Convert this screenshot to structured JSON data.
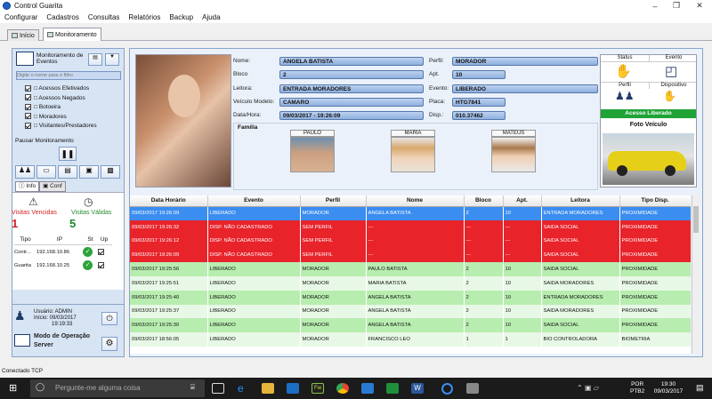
{
  "window": {
    "title": "Control Guarita"
  },
  "menu": [
    "Configurar",
    "Cadastros",
    "Consultas",
    "Relatórios",
    "Backup",
    "Ajuda"
  ],
  "tabs": [
    {
      "label": "Início"
    },
    {
      "label": "Monitoramento"
    }
  ],
  "left": {
    "monitor_title": "Monitoramento de Eventos",
    "search_placeholder": "Digite o nome para o filtro",
    "filters": [
      "Acessos Efetivados",
      "Acessos Negados",
      "Botoeira",
      "Moradores",
      "Visitantes/Prestadores"
    ],
    "pause_label": "Pausar Monitoramento",
    "subtabs": [
      "Info",
      "Conf"
    ],
    "visitas_vencidas_label": "Visitas Vencidas",
    "visitas_vencidas_count": "1",
    "visitas_validas_label": "Visitas Válidas",
    "visitas_validas_count": "5",
    "device_headers": [
      "Tipo",
      "IP",
      "St",
      "Up"
    ],
    "devices": [
      {
        "tipo": "Contr...",
        "ip": "192.168.10.86"
      },
      {
        "tipo": "Guarita",
        "ip": "192.168.10.25"
      }
    ],
    "user_info": {
      "line1": "Usuário: ADMIN",
      "line2": "Início: 09/03/2017",
      "line3": "19:19:33"
    },
    "mode_label": "Modo de Operação",
    "mode_value": "Server"
  },
  "detail": {
    "nome_label": "Nome:",
    "nome": "ANGELA BATISTA",
    "bloco_label": "Bloco",
    "bloco": "2",
    "leitora_label": "Leitora:",
    "leitora": "ENTRADA MORADORES",
    "veiculo_label": "Veículo Modelo:",
    "veiculo": "CAMARO",
    "datahora_label": "Data/Hora:",
    "datahora": "09/03/2017 - 19:26:09",
    "perfil_label": "Perfil:",
    "perfil": "MORADOR",
    "apt_label": "Apt.",
    "apt": "10",
    "evento_label": "Evento:",
    "evento": "LIBERADO",
    "placa_label": "Placa:",
    "placa": "HTG7841",
    "disp_label": "Disp.:",
    "disp": "010.37462",
    "familia_label": "Família",
    "familia": [
      {
        "nome": "PAULO"
      },
      {
        "nome": "MARIA"
      },
      {
        "nome": "MATEUS"
      }
    ]
  },
  "status_panel": {
    "status_label": "Status",
    "evento_label": "Evento",
    "perfil_label": "Perfil",
    "dispositivo_label": "Dispositivo",
    "access_banner": "Acesso Liberado",
    "foto_veiculo_label": "Foto Veículo",
    "banner_color": "#1fa336"
  },
  "grid": {
    "headers": [
      "Data Horário",
      "Evento",
      "Perfil",
      "Nome",
      "Bloco",
      "Apt.",
      "Leitora",
      "Tipo Disp."
    ],
    "rows": [
      {
        "style": "sel",
        "cells": [
          "09/03/2017 19:26:09",
          "LIBERADO",
          "MORADOR",
          "ANGELA BATISTA",
          "2",
          "10",
          "ENTRADA MORADORES",
          "PROXIMIDADE"
        ]
      },
      {
        "style": "red",
        "cells": [
          "09/03/2017 19:26:32",
          "DISP. NÃO CADASTRADO",
          "SEM PERFIL",
          "---",
          "---",
          "---",
          "SAIDA SOCIAL",
          "PROXIMIDADE"
        ]
      },
      {
        "style": "red",
        "cells": [
          "09/03/2017 19:26:12",
          "DISP. NÃO CADASTRADO",
          "SEM PERFIL",
          "---",
          "---",
          "---",
          "SAIDA SOCIAL",
          "PROXIMIDADE"
        ]
      },
      {
        "style": "red",
        "cells": [
          "09/03/2017 19:26:09",
          "DISP. NÃO CADASTRADO",
          "SEM PERFIL",
          "---",
          "---",
          "---",
          "SAIDA SOCIAL",
          "PROXIMIDADE"
        ]
      },
      {
        "style": "green1",
        "cells": [
          "09/03/2017 19:25:56",
          "LIBERADO",
          "MORADOR",
          "PAULO BATISTA",
          "2",
          "10",
          "SAIDA SOCIAL",
          "PROXIMIDADE"
        ]
      },
      {
        "style": "green2",
        "cells": [
          "09/03/2017 19:25:51",
          "LIBERADO",
          "MORADOR",
          "MARIA BATISTA",
          "2",
          "10",
          "SAIDA MORADORES",
          "PROXIMIDADE"
        ]
      },
      {
        "style": "green1",
        "cells": [
          "09/03/2017 19:25:40",
          "LIBERADO",
          "MORADOR",
          "ANGELA BATISTA",
          "2",
          "10",
          "ENTRADA MORADORES",
          "PROXIMIDADE"
        ]
      },
      {
        "style": "green2",
        "cells": [
          "09/03/2017 19:25:37",
          "LIBERADO",
          "MORADOR",
          "ANGELA BATISTA",
          "2",
          "10",
          "SAIDA MORADORES",
          "PROXIMIDADE"
        ]
      },
      {
        "style": "green1",
        "cells": [
          "09/03/2017 19:25:30",
          "LIBERADO",
          "MORADOR",
          "ANGELA BATISTA",
          "2",
          "10",
          "SAIDA SOCIAL",
          "PROXIMIDADE"
        ]
      },
      {
        "style": "green2",
        "cells": [
          "09/03/2017 18:56:05",
          "LIBERADO",
          "MORADOR",
          "FRANCISCO LEO",
          "1",
          "1",
          "BIO CONTROLADORA",
          "BIOMETRIA"
        ]
      }
    ]
  },
  "statusbar": {
    "text": "Conectado TCP"
  },
  "taskbar": {
    "search_placeholder": "Pergunte-me alguma coisa",
    "lang1": "POR",
    "lang2": "PTB2",
    "time": "19:30",
    "date": "09/03/2017"
  }
}
